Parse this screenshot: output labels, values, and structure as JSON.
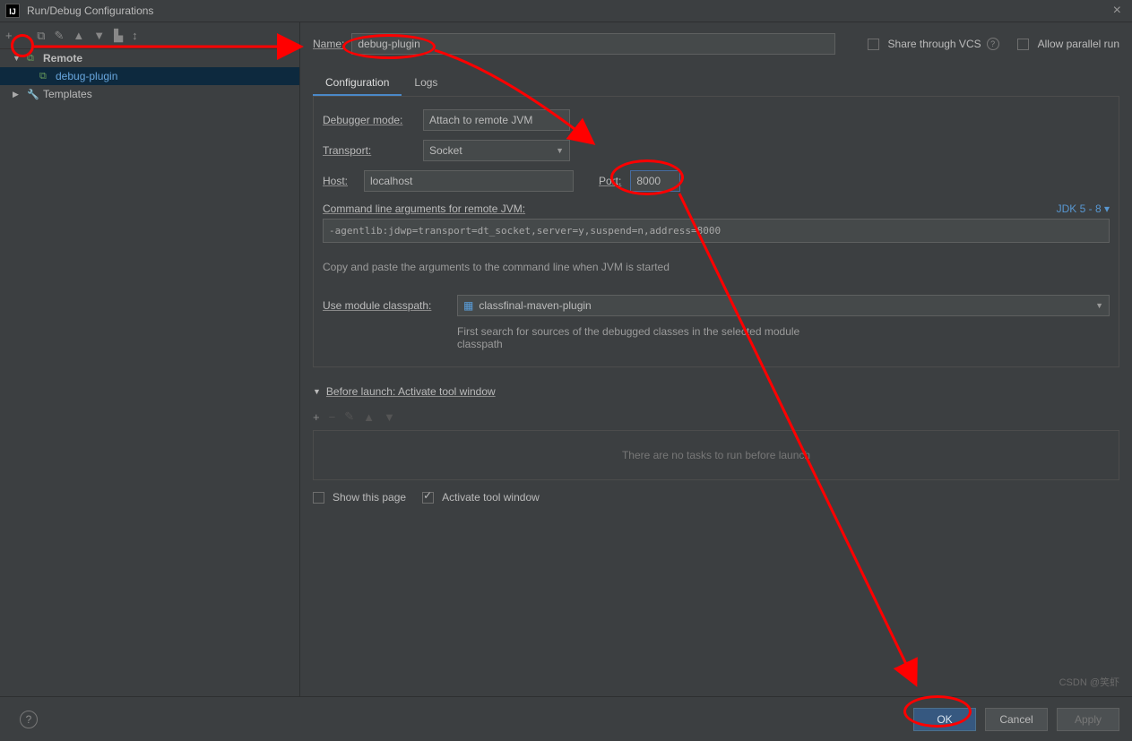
{
  "title": "Run/Debug Configurations",
  "sidebar": {
    "items": [
      {
        "label": "Remote",
        "expanded": true
      },
      {
        "label": "debug-plugin",
        "selected": true
      },
      {
        "label": "Templates"
      }
    ]
  },
  "header": {
    "name_label": "Name:",
    "name_value": "debug-plugin",
    "share_label": "Share through VCS",
    "parallel_label": "Allow parallel run"
  },
  "tabs": {
    "t1": "Configuration",
    "t2": "Logs"
  },
  "form": {
    "debugger_mode_lbl": "Debugger mode:",
    "debugger_mode_val": "Attach to remote JVM",
    "transport_lbl": "Transport:",
    "transport_val": "Socket",
    "host_lbl": "Host:",
    "host_val": "localhost",
    "port_lbl": "Port:",
    "port_val": "8000",
    "cmd_lbl": "Command line arguments for remote JVM:",
    "jdk_link": "JDK 5 - 8 ",
    "cmd_val": "-agentlib:jdwp=transport=dt_socket,server=y,suspend=n,address=8000",
    "cmd_hint": "Copy and paste the arguments to the command line when JVM is started",
    "module_lbl": "Use module classpath:",
    "module_val": "classfinal-maven-plugin",
    "module_hint": "First search for sources of the debugged classes in the selected module classpath"
  },
  "before": {
    "header": "Before launch: Activate tool window",
    "empty": "There are no tasks to run before launch",
    "show_page": "Show this page",
    "activate": "Activate tool window"
  },
  "footer": {
    "ok": "OK",
    "cancel": "Cancel",
    "apply": "Apply"
  },
  "watermark": "CSDN @笑虾"
}
